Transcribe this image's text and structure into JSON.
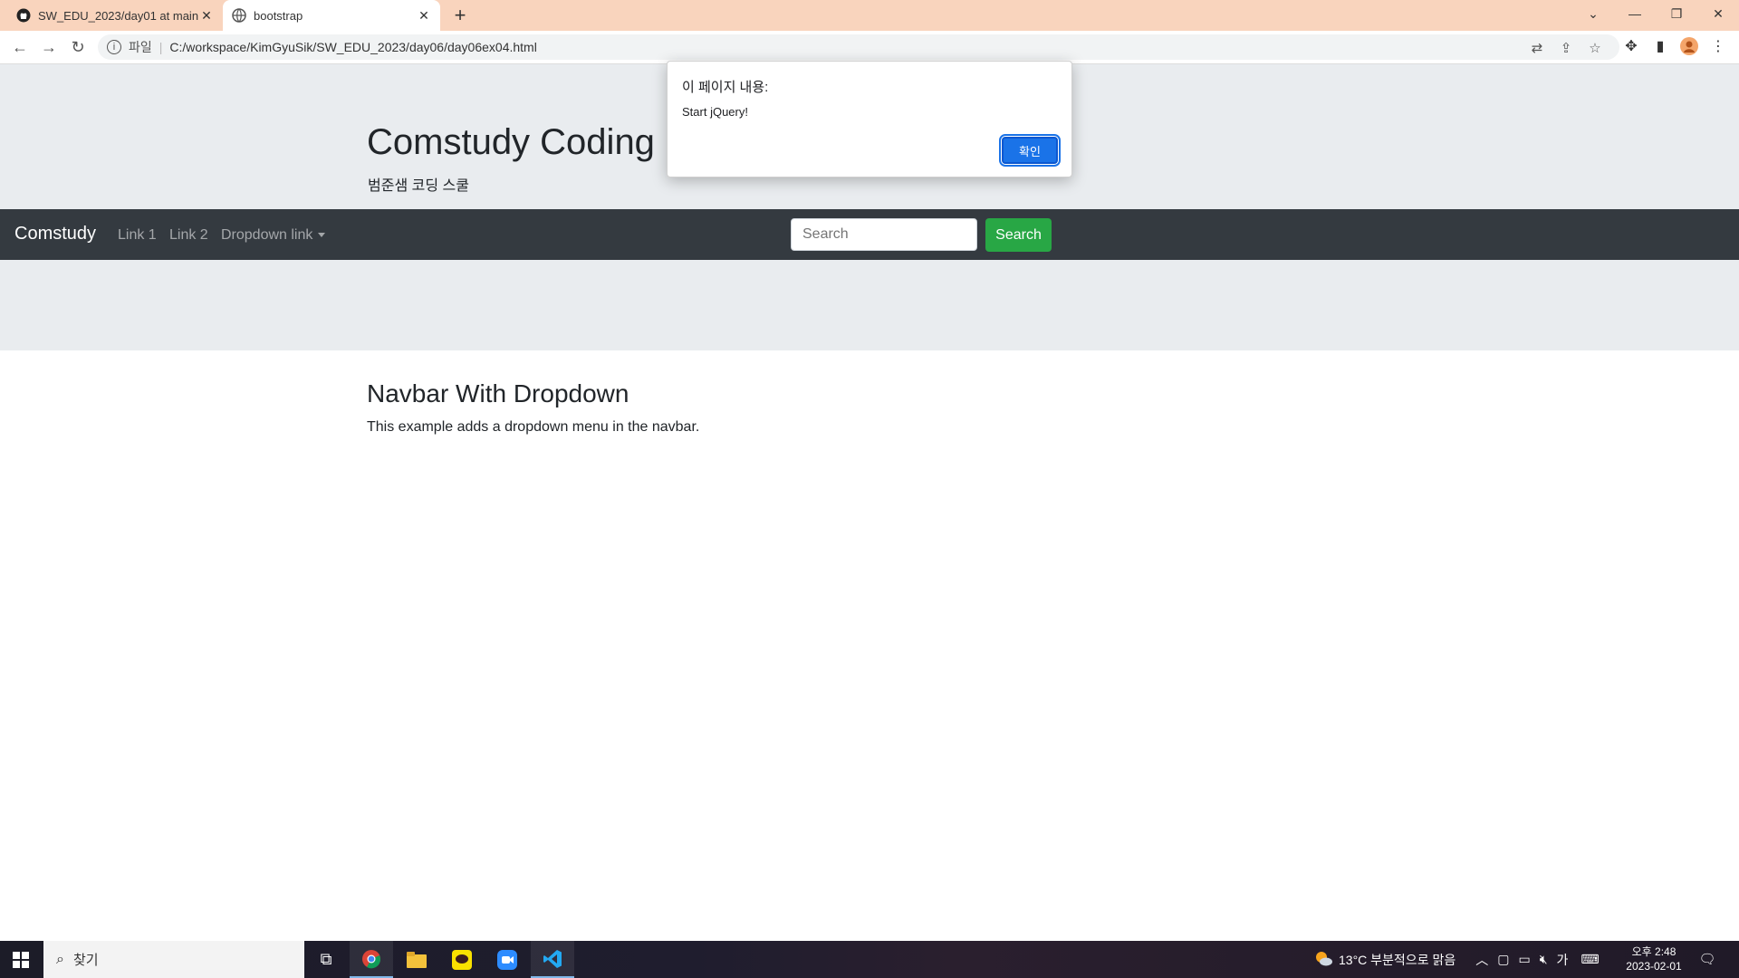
{
  "browser": {
    "tabs": [
      {
        "title": "SW_EDU_2023/day01 at main · ",
        "icon": "github-icon"
      },
      {
        "title": "bootstrap",
        "icon": "globe-icon"
      }
    ],
    "address": {
      "scheme": "파일",
      "url": "C:/workspace/KimGyuSik/SW_EDU_2023/day06/day06ex04.html"
    }
  },
  "page": {
    "header_title": "Comstudy Coding",
    "header_subtitle": "범준샘 코딩 스쿨",
    "navbar": {
      "brand": "Comstudy",
      "links": [
        "Link 1",
        "Link 2",
        "Dropdown link"
      ],
      "search_placeholder": "Search",
      "search_button": "Search"
    },
    "content": {
      "heading": "Navbar With Dropdown",
      "text": "This example adds a dropdown menu in the navbar."
    }
  },
  "alert": {
    "title": "이 페이지 내용:",
    "message": "Start jQuery!",
    "ok_label": "확인"
  },
  "taskbar": {
    "search_label": "찾기",
    "weather": "13°C  부분적으로 맑음",
    "ime": "가",
    "time": "오후 2:48",
    "date": "2023-02-01"
  },
  "colors": {
    "tabstrip": "#f9d4bd",
    "jumbotron": "#e9ecef",
    "navbar": "#343a40",
    "search_button": "#28a745",
    "dialog_button": "#1a73e8"
  }
}
